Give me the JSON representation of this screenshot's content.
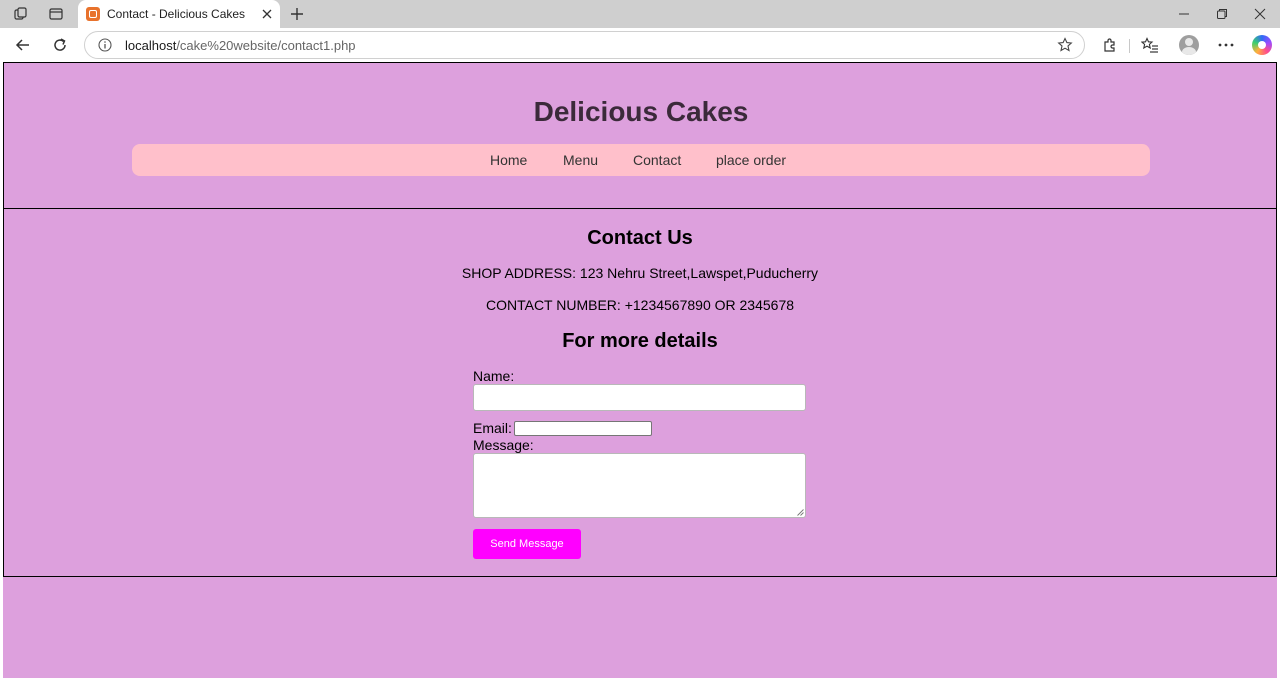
{
  "browser": {
    "tab_title": "Contact - Delicious Cakes",
    "url_host": "localhost",
    "url_path": "/cake%20website/contact1.php"
  },
  "site": {
    "title": "Delicious Cakes",
    "nav": [
      {
        "label": "Home"
      },
      {
        "label": "Menu"
      },
      {
        "label": "Contact"
      },
      {
        "label": "place order"
      }
    ]
  },
  "contact": {
    "heading": "Contact Us",
    "address": "SHOP ADDRESS: 123 Nehru Street,Lawspet,Puducherry",
    "phone": "CONTACT NUMBER: +1234567890 OR 2345678",
    "form_heading": "For more details",
    "form": {
      "name_label": "Name:",
      "name_value": "",
      "email_label": "Email:",
      "email_value": "",
      "message_label": "Message:",
      "message_value": "",
      "submit_label": "Send Message"
    }
  },
  "colors": {
    "page_bg": "#dda0dd",
    "nav_bg": "#ffc0cb",
    "button_bg": "#ff00ff"
  },
  "icons": [
    "tab-actions-icon",
    "tab-strip-icon",
    "site-favicon-icon",
    "close-icon",
    "plus-icon",
    "minimize-icon",
    "restore-icon",
    "window-close-icon",
    "back-arrow-icon",
    "refresh-icon",
    "info-icon",
    "star-icon",
    "extensions-icon",
    "favorites-icon",
    "profile-avatar-icon",
    "more-icon",
    "copilot-icon"
  ]
}
